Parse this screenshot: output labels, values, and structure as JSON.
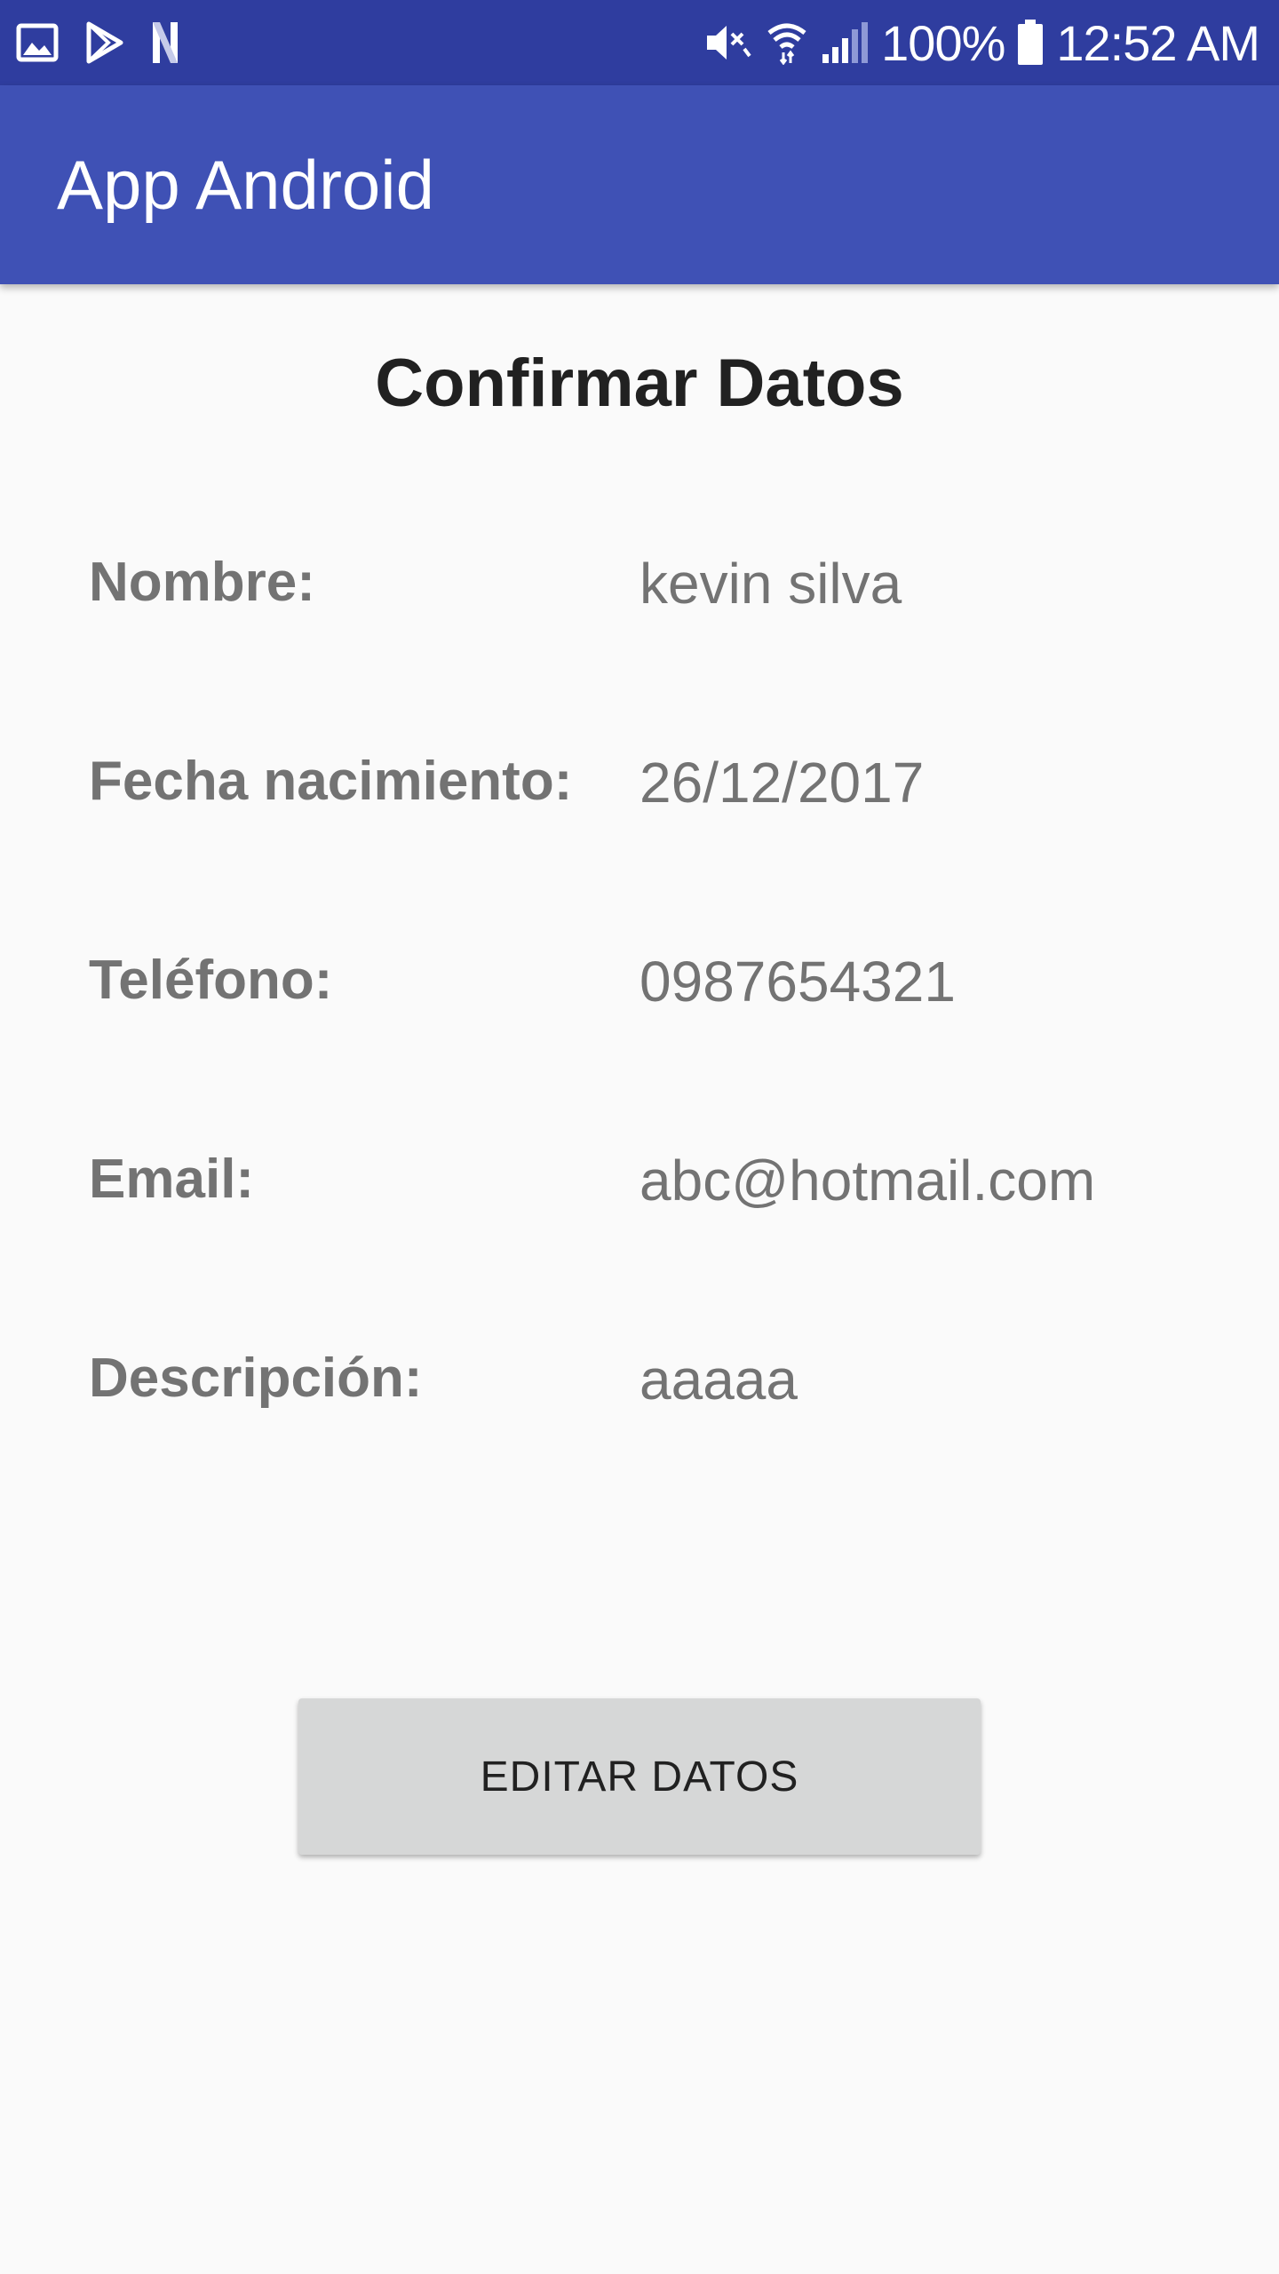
{
  "status_bar": {
    "left_icons": [
      "gallery-icon",
      "play-store-icon",
      "netflix-icon"
    ],
    "right_icons": [
      "mute-icon",
      "wifi-icon",
      "signal-icon",
      "battery-icon"
    ],
    "battery_text": "100%",
    "time": "12:52 AM",
    "background": "#2f3d9f"
  },
  "app_bar": {
    "title": "App Android",
    "background": "#3f51b5"
  },
  "main": {
    "title": "Confirmar Datos",
    "fields": [
      {
        "label": "Nombre:",
        "value": "kevin silva"
      },
      {
        "label": "Fecha nacimiento:",
        "value": "26/12/2017"
      },
      {
        "label": "Teléfono:",
        "value": "0987654321"
      },
      {
        "label": "Email:",
        "value": "abc@hotmail.com"
      },
      {
        "label": "Descripción:",
        "value": "aaaaa"
      }
    ],
    "edit_button_label": "EDITAR DATOS"
  }
}
